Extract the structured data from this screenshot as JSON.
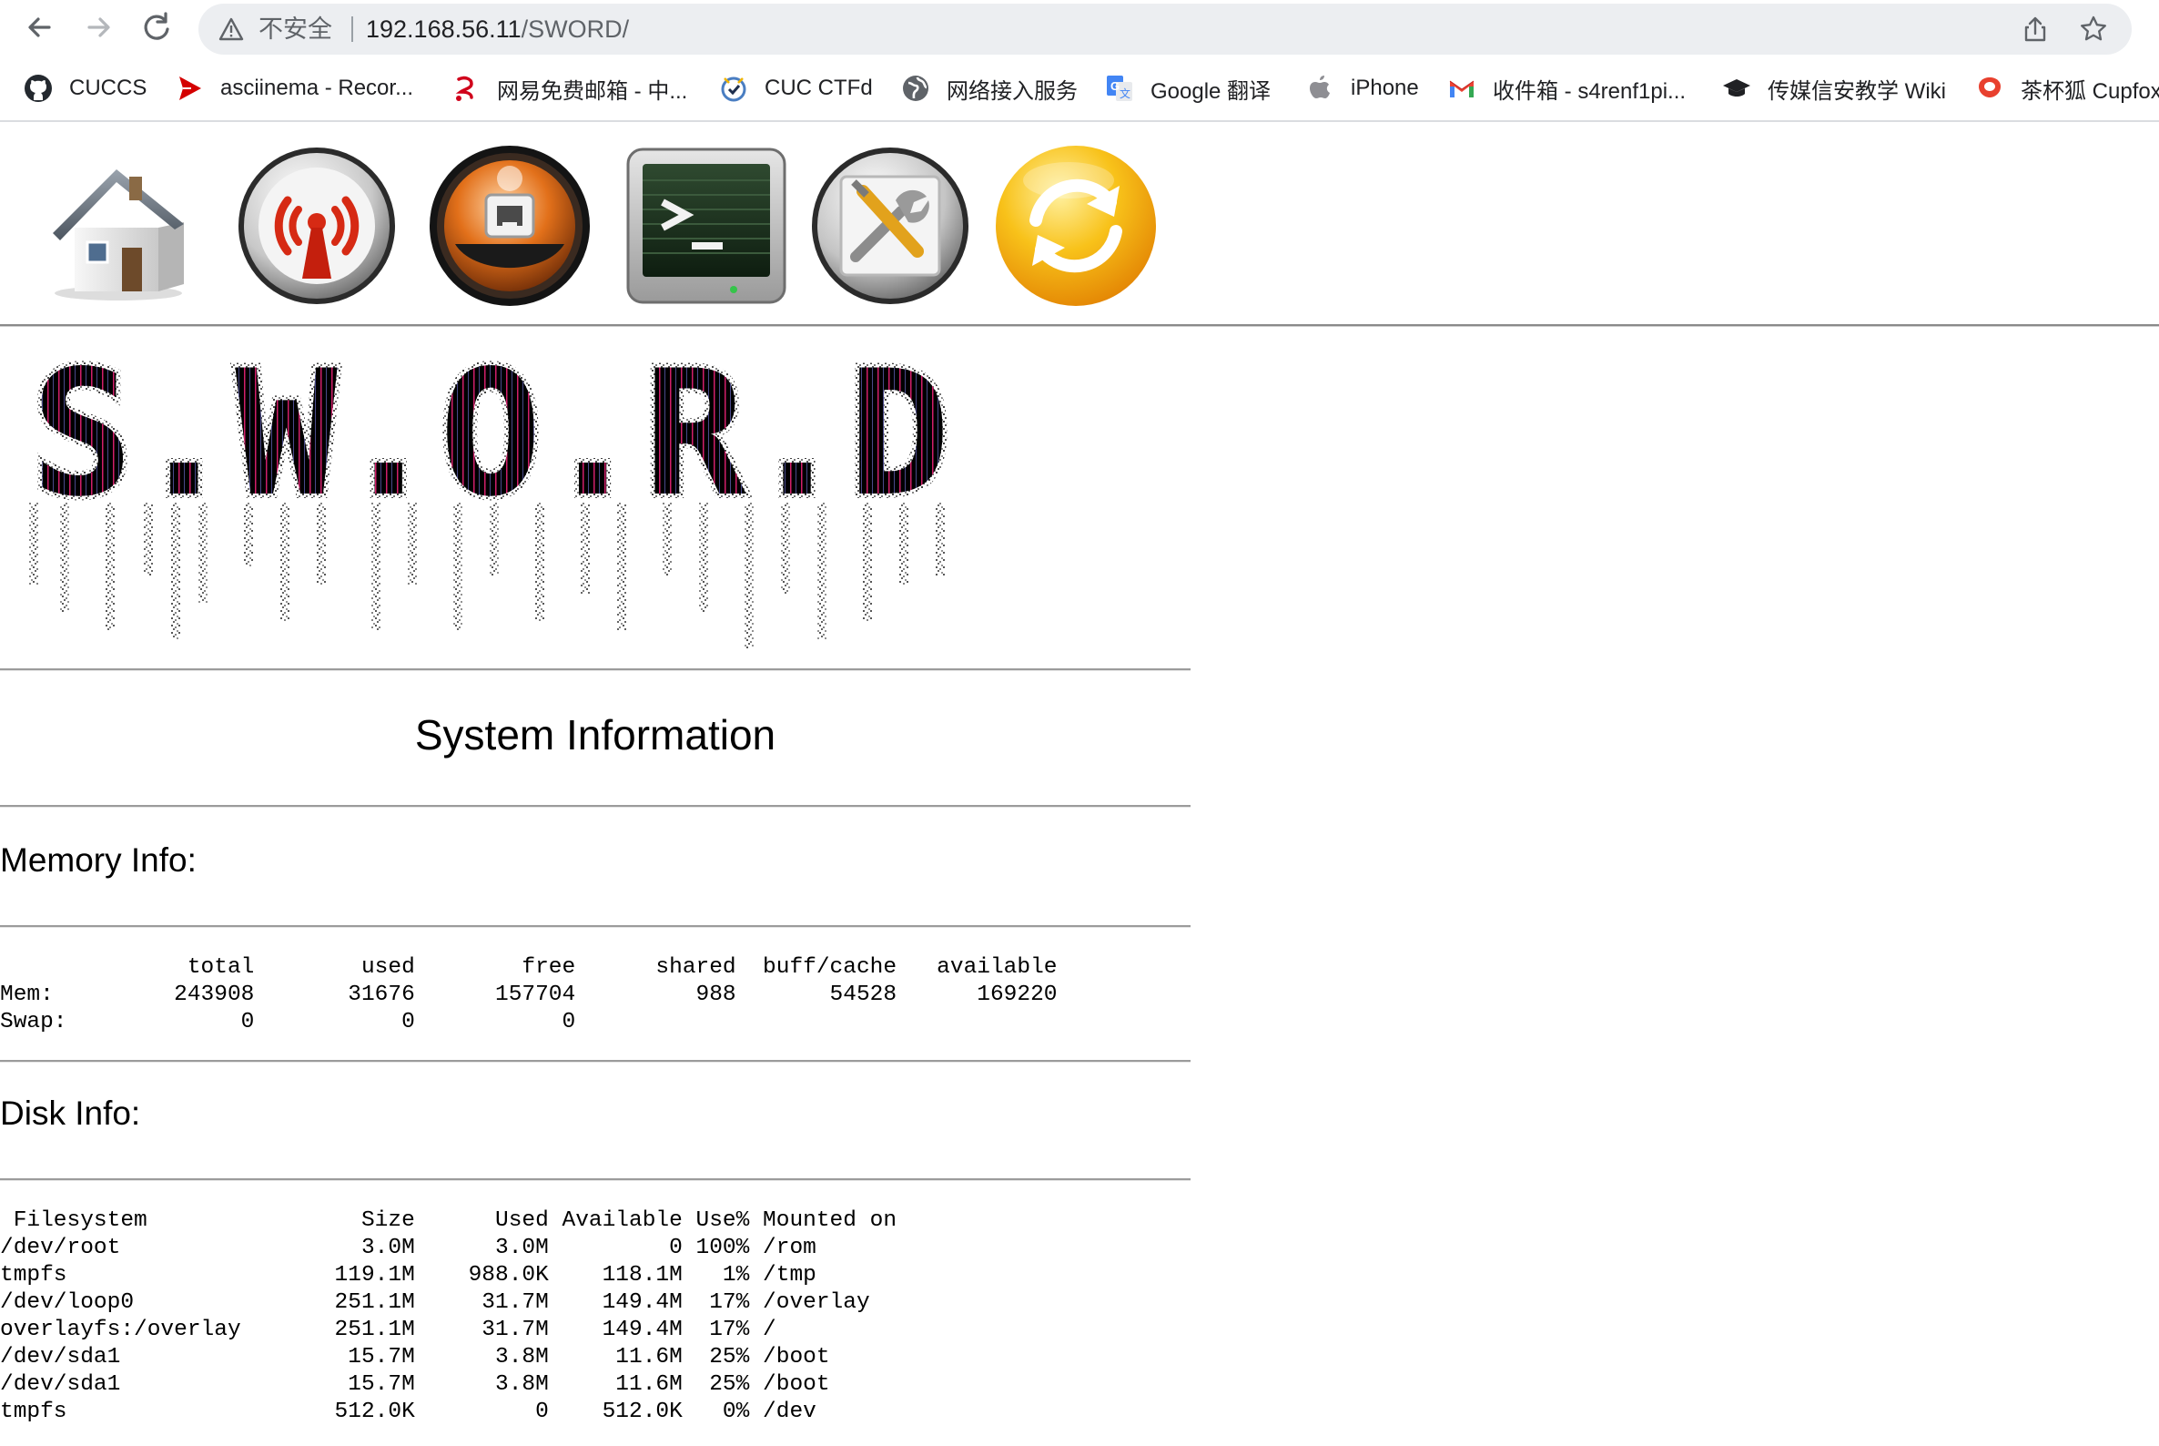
{
  "browser": {
    "insecure_label": "不安全",
    "url_host": "192.168.56.11",
    "url_path": "/SWORD/",
    "bookmarks": [
      {
        "label": "CUCCS",
        "icon": "github-icon"
      },
      {
        "label": "asciinema - Recor...",
        "icon": "asciinema-icon"
      },
      {
        "label": "网易免费邮箱 - 中...",
        "icon": "netease-mail-icon"
      },
      {
        "label": "CUC CTFd",
        "icon": "ctfd-icon"
      },
      {
        "label": "网络接入服务",
        "icon": "globe-icon"
      },
      {
        "label": "Google 翻译",
        "icon": "google-translate-icon"
      },
      {
        "label": "iPhone",
        "icon": "apple-icon"
      },
      {
        "label": "收件箱 - s4renf1pi...",
        "icon": "gmail-icon"
      },
      {
        "label": "传媒信安教学 Wiki",
        "icon": "mortarboard-icon"
      },
      {
        "label": "茶杯狐 Cupfox",
        "icon": "cupfox-icon"
      }
    ]
  },
  "toolbar_icons": [
    "home-icon",
    "wireless-icon",
    "network-icon",
    "terminal-icon",
    "settings-icon",
    "refresh-icon"
  ],
  "logo_text": "S.W.O.R.D",
  "colors": {
    "logo_fill": "#000000",
    "logo_accent": "#d11f6a",
    "refresh_orange": "#f5a20a",
    "wireless_red": "#d62a14"
  },
  "page": {
    "title": "System Information",
    "memory_heading": "Memory Info:",
    "memory_output": "              total        used        free      shared  buff/cache   available\nMem:         243908       31676      157704         988       54528      169220\nSwap:             0           0           0",
    "disk_heading": "Disk Info:",
    "disk_output": " Filesystem                Size      Used Available Use% Mounted on\n/dev/root                  3.0M      3.0M         0 100% /rom\ntmpfs                    119.1M    988.0K    118.1M   1% /tmp\n/dev/loop0               251.1M     31.7M    149.4M  17% /overlay\noverlayfs:/overlay       251.1M     31.7M    149.4M  17% /\n/dev/sda1                 15.7M      3.8M     11.6M  25% /boot\n/dev/sda1                 15.7M      3.8M     11.6M  25% /boot\ntmpfs                    512.0K         0    512.0K   0% /dev"
  }
}
